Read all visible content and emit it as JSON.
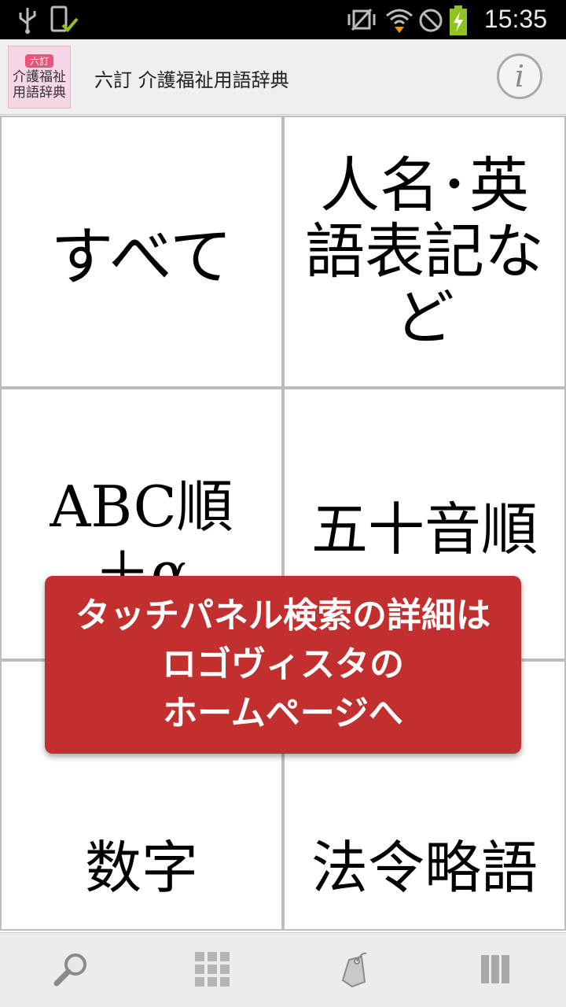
{
  "status_bar": {
    "time": "15:35",
    "icons": [
      "usb-icon",
      "phone-check-icon",
      "vibrate-icon",
      "wifi-icon",
      "no-signal-icon",
      "battery-charging-icon"
    ]
  },
  "header": {
    "title": "六訂 介護福祉用語辞典",
    "app_icon": {
      "badge": "六訂",
      "line1": "介護福祉",
      "line2": "用語辞典"
    },
    "info_icon": "info-icon"
  },
  "grid": {
    "all": "すべて",
    "names_lines": [
      "人名･英",
      "語表記な",
      "ど"
    ],
    "abc_lines": [
      "ABC順",
      "＋α"
    ],
    "gojuon": "五十音順",
    "numbers": "数字",
    "law_abbr": "法令略語"
  },
  "toast": {
    "lines": [
      "タッチパネル検索の詳細は",
      "ロゴヴィスタの",
      "ホームページへ"
    ]
  },
  "toolbar": {
    "icons": [
      "search-icon",
      "grid-icon",
      "history-tag-icon",
      "columns-icon"
    ]
  },
  "colors": {
    "toast_bg": "#c12f2f",
    "header_bg": "#efefef",
    "toolbar_bg": "#ececec"
  }
}
